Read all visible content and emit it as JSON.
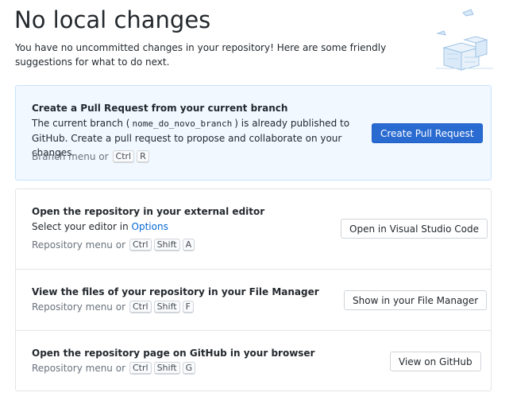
{
  "header": {
    "title": "No local changes",
    "subtitle": "You have no uncommitted changes in your repository! Here are some friendly suggestions for what to do next."
  },
  "pull_request": {
    "title": "Create a Pull Request from your current branch",
    "desc_prefix": "The current branch (",
    "branch_name": "nome_do_novo_branch",
    "desc_suffix": ") is already published to GitHub. Create a pull request to propose and collaborate on your changes.",
    "shortcut_text": "Branch menu or",
    "keys": [
      "Ctrl",
      "R"
    ],
    "button_label": "Create Pull Request"
  },
  "editor": {
    "title": "Open the repository in your external editor",
    "desc_prefix": "Select your editor in",
    "options_link": "Options",
    "shortcut_text": "Repository menu or",
    "keys": [
      "Ctrl",
      "Shift",
      "A"
    ],
    "button_label": "Open in Visual Studio Code"
  },
  "file_manager": {
    "title": "View the files of your repository in your File Manager",
    "shortcut_text": "Repository menu or",
    "keys": [
      "Ctrl",
      "Shift",
      "F"
    ],
    "button_label": "Show in your File Manager"
  },
  "github": {
    "title": "Open the repository page on GitHub in your browser",
    "shortcut_text": "Repository menu or",
    "keys": [
      "Ctrl",
      "Shift",
      "G"
    ],
    "button_label": "View on GitHub"
  },
  "colors": {
    "primary_button": "#2a6bd1",
    "highlight_background": "#f1f8ff",
    "link": "#0366d6"
  }
}
